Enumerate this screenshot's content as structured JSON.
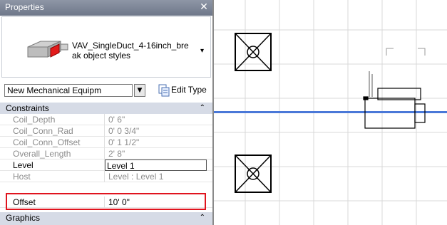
{
  "palette": {
    "title": "Properties",
    "type_selector": {
      "name": "VAV_SingleDuct_4-16inch_break object styles"
    },
    "instance_selector": {
      "value": "New Mechanical Equipm",
      "edit_type_label": "Edit Type"
    },
    "sections": {
      "constraints": "Constraints",
      "graphics": "Graphics"
    },
    "params": [
      {
        "name": "Coil_Depth",
        "value": "0'  6\""
      },
      {
        "name": "Coil_Conn_Rad",
        "value": "0'  0 3/4\""
      },
      {
        "name": "Coil_Conn_Offset",
        "value": "0'  1 1/2\""
      },
      {
        "name": "Overall_Length",
        "value": "2'  8\""
      },
      {
        "name": "Level",
        "value": "Level 1"
      },
      {
        "name": "Host",
        "value": "Level : Level 1"
      },
      {
        "name": "Offset",
        "value": "10'  0\""
      }
    ]
  },
  "colors": {
    "titlebar": "#6e7789",
    "section_bg": "#d6dbe6",
    "highlight": "#e0141e",
    "duct_line": "#4a78d8",
    "grid": "#d9d9d9"
  },
  "icons": {
    "close": "close-icon",
    "type_preview": "vav-box-preview-icon",
    "edit_type": "edit-type-icon",
    "collapse": "chevron-up-icon"
  }
}
